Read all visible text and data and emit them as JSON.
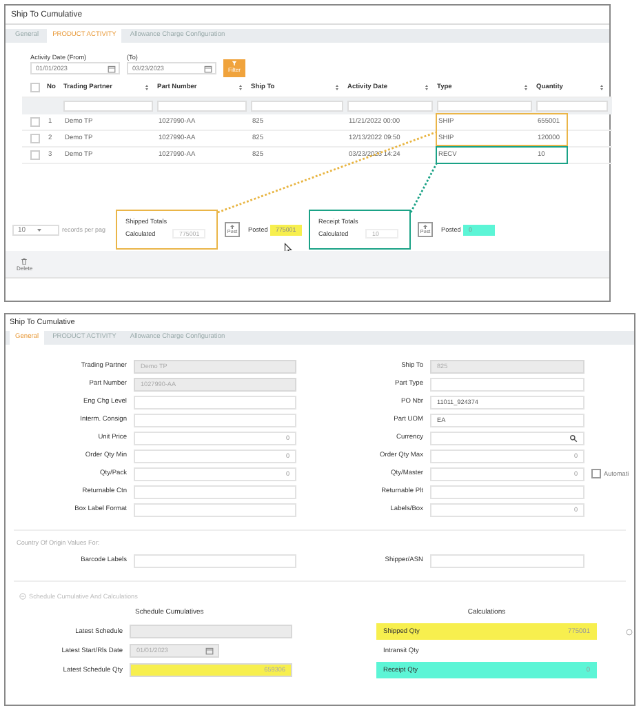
{
  "activity_window": {
    "title": "Ship To Cumulative",
    "tabs": [
      {
        "label": "General",
        "selected": false
      },
      {
        "label": "PRODUCT ACTIVITY",
        "selected": true
      },
      {
        "label": "Allowance Charge Configuration",
        "selected": false
      }
    ],
    "date_from": {
      "label": "Activity Date (From)",
      "value": "01/01/2023"
    },
    "date_to": {
      "label": "(To)",
      "value": "03/23/2023"
    },
    "filter_button": "Filter",
    "table": {
      "all_selected": false,
      "columns": [
        "No",
        "Trading Partner",
        "Part Number",
        "Ship To",
        "Activity Date",
        "Type",
        "Quantity"
      ],
      "rows": [
        {
          "selected": false,
          "cells": [
            "1",
            "Demo TP",
            "1027990-AA",
            "825",
            "11/21/2022 00:00",
            "SHIP",
            "655001"
          ]
        },
        {
          "selected": false,
          "cells": [
            "2",
            "Demo TP",
            "1027990-AA",
            "825",
            "12/13/2022 09:50",
            "SHIP",
            "120000"
          ]
        },
        {
          "selected": false,
          "cells": [
            "3",
            "Demo TP",
            "1027990-AA",
            "825",
            "03/23/2023 14:24",
            "RECV",
            "10"
          ]
        }
      ]
    },
    "page_size": "10",
    "page_size_label": "records per pag",
    "totals": [
      {
        "title": "Shipped Totals",
        "calculated_label": "Calculated",
        "calculated": "775001",
        "post_button": "Post",
        "posted_label": "Posted",
        "posted": "775001",
        "color": "#f7ef4e"
      },
      {
        "title": "Receipt Totals",
        "calculated_label": "Calculated",
        "calculated": "10",
        "post_button": "Post",
        "posted_label": "Posted",
        "posted": "0",
        "color": "#5cf5d6"
      }
    ],
    "toolbar": [
      "Delete"
    ]
  },
  "general_window": {
    "title": "Ship To Cumulative",
    "tabs": [
      {
        "label": "General",
        "selected": true
      },
      {
        "label": "PRODUCT ACTIVITY",
        "selected": false
      },
      {
        "label": "Allowance Charge Configuration",
        "selected": false
      }
    ],
    "left_fields": [
      {
        "label": "Trading Partner",
        "kind": "text",
        "value": "Demo TP",
        "disabled": true
      },
      {
        "label": "Part Number",
        "kind": "text",
        "value": "1027990-AA",
        "disabled": true
      },
      {
        "label": "Eng Chg Level",
        "kind": "text",
        "disabled": false
      },
      {
        "label": "Interm. Consign",
        "kind": "text",
        "disabled": false
      },
      {
        "label": "Unit Price",
        "kind": "number",
        "value": "0",
        "disabled": false
      },
      {
        "label": "Order Qty Min",
        "kind": "number",
        "value": "0",
        "disabled": false
      },
      {
        "label": "Qty/Pack",
        "kind": "number",
        "value": "0",
        "disabled": false
      },
      {
        "label": "Returnable Ctn",
        "kind": "text",
        "disabled": false
      },
      {
        "label": "Box Label Format",
        "kind": "text",
        "disabled": false
      }
    ],
    "right_fields": [
      {
        "label": "Ship To",
        "kind": "text",
        "value": "825",
        "disabled": true
      },
      {
        "label": "Part Type",
        "kind": "text",
        "disabled": false
      },
      {
        "label": "PO Nbr",
        "kind": "text",
        "value": "11011_924374",
        "disabled": false
      },
      {
        "label": "Part UOM",
        "kind": "text",
        "value": "EA",
        "disabled": false
      },
      {
        "label": "Currency",
        "kind": "lookup",
        "disabled": false
      },
      {
        "label": "Order Qty Max",
        "kind": "number",
        "value": "0",
        "disabled": false
      },
      {
        "label": "Qty/Master",
        "kind": "number",
        "value": "0",
        "disabled": false,
        "checkbox": {
          "label": "Automati",
          "checked": false
        }
      },
      {
        "label": "Returnable Plt",
        "kind": "text",
        "disabled": false
      },
      {
        "label": "Labels/Box",
        "kind": "number",
        "value": "0",
        "disabled": false
      }
    ],
    "origin_section": {
      "title": "Country Of Origin Values For:",
      "fields": [
        {
          "label": "Barcode Labels",
          "kind": "text",
          "disabled": false
        },
        {
          "label": "Shipper/ASN",
          "kind": "text",
          "disabled": false
        }
      ]
    },
    "schedule_section": {
      "title": "Schedule Cumulative And Calculations",
      "cumulatives": {
        "heading": "Schedule Cumulatives",
        "fields": [
          {
            "label": "Latest Schedule",
            "kind": "text",
            "disabled": true
          },
          {
            "label": "Latest Start/Rls Date",
            "kind": "date",
            "value": "01/01/2023",
            "disabled": true
          },
          {
            "label": "Latest Schedule Qty",
            "kind": "number",
            "value": "659306",
            "disabled": true,
            "color": "#f7ef4e"
          }
        ]
      },
      "calculations": {
        "heading": "Calculations",
        "fields": [
          {
            "label": "Shipped Qty",
            "value": "775001",
            "color": "#f7ef4e"
          },
          {
            "label": "Intransit Qty"
          },
          {
            "label": "Receipt Qty",
            "value": "0",
            "color": "#5cf5d6"
          }
        ]
      }
    }
  }
}
